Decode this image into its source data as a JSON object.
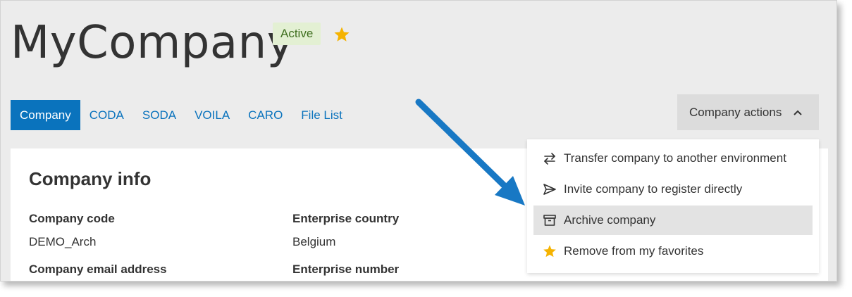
{
  "header": {
    "title": "MyCompany",
    "status_badge": "Active",
    "favorite_icon": "star-icon"
  },
  "tabs": [
    {
      "label": "Company",
      "active": true
    },
    {
      "label": "CODA",
      "active": false
    },
    {
      "label": "SODA",
      "active": false
    },
    {
      "label": "VOILA",
      "active": false
    },
    {
      "label": "CARO",
      "active": false
    },
    {
      "label": "File List",
      "active": false
    }
  ],
  "actions": {
    "button_label": "Company actions",
    "chevron_icon": "chevron-up-icon",
    "menu": [
      {
        "label": "Transfer company to another environment",
        "icon": "swap-arrows-icon"
      },
      {
        "label": "Invite company to register directly",
        "icon": "send-icon"
      },
      {
        "label": "Archive company",
        "icon": "archive-box-icon",
        "highlighted": true
      },
      {
        "label": "Remove from my favorites",
        "icon": "star-icon"
      }
    ]
  },
  "company_info": {
    "title": "Company info",
    "fields": {
      "company_code_label": "Company code",
      "company_code_value": "DEMO_Arch",
      "enterprise_country_label": "Enterprise country",
      "enterprise_country_value": "Belgium",
      "company_email_label": "Company email address",
      "enterprise_number_label": "Enterprise number"
    }
  },
  "colors": {
    "primary_blue": "#0a73bd",
    "badge_bg": "#e3f0d3",
    "star_yellow": "#f5b301",
    "annotation_arrow": "#1878c4"
  }
}
